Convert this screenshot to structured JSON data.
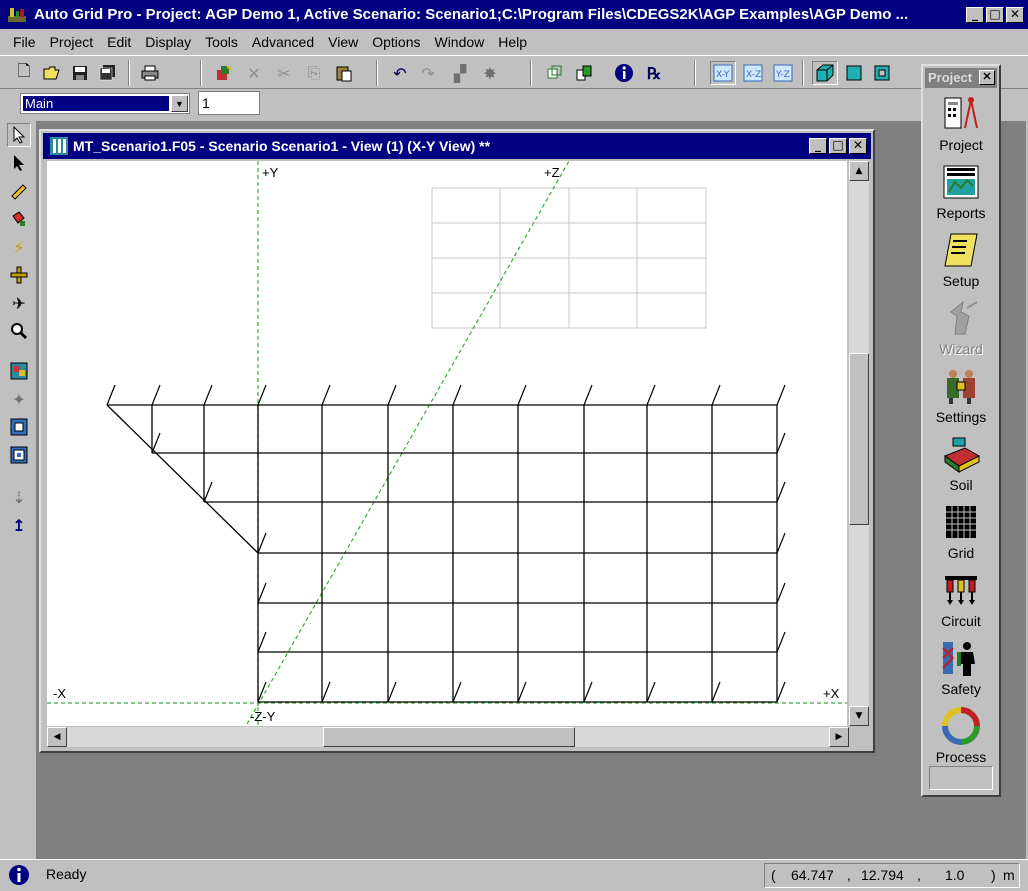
{
  "window": {
    "title": "Auto Grid Pro - Project: AGP Demo 1, Active Scenario: Scenario1;C:\\Program Files\\CDEGS2K\\AGP Examples\\AGP Demo ...",
    "min": "_",
    "max": "□",
    "close": "✕"
  },
  "menu": {
    "file": "File",
    "project": "Project",
    "edit": "Edit",
    "display": "Display",
    "tools": "Tools",
    "advanced": "Advanced",
    "view": "View",
    "options": "Options",
    "window": "Window",
    "help": "Help"
  },
  "toolbar2": {
    "scenario_value": "Main",
    "view_number": "1"
  },
  "child": {
    "title": "MT_Scenario1.F05 - Scenario Scenario1 - View (1) (X-Y View) **",
    "min": "_",
    "max": "□",
    "close": "✕"
  },
  "canvas": {
    "axis_plus_y": "+Y",
    "axis_plus_z": "+Z",
    "axis_minus_x": "-X",
    "axis_plus_x": "+X",
    "axis_minus_z_minus_y": "-Z-Y"
  },
  "palette": {
    "title": "Project",
    "close": "✕",
    "items": [
      {
        "label": "Project",
        "icon": "project-icon",
        "enabled": true
      },
      {
        "label": "Reports",
        "icon": "reports-icon",
        "enabled": true
      },
      {
        "label": "Setup",
        "icon": "setup-icon",
        "enabled": true
      },
      {
        "label": "Wizard",
        "icon": "wizard-icon",
        "enabled": false
      },
      {
        "label": "Settings",
        "icon": "settings-icon",
        "enabled": true
      },
      {
        "label": "Soil",
        "icon": "soil-icon",
        "enabled": true
      },
      {
        "label": "Grid",
        "icon": "grid-icon",
        "enabled": true
      },
      {
        "label": "Circuit",
        "icon": "circuit-icon",
        "enabled": true
      },
      {
        "label": "Safety",
        "icon": "safety-icon",
        "enabled": true
      },
      {
        "label": "Process",
        "icon": "process-icon",
        "enabled": true
      }
    ]
  },
  "status": {
    "text": "Ready",
    "open": "(",
    "x": "64.747",
    "sep1": ",",
    "y": "12.794",
    "sep2": ",",
    "z": "1.0",
    "close": ")",
    "unit": "m"
  },
  "colors": {
    "titlebar": "#000080",
    "face": "#c0c0c0",
    "mdi_background": "#808080",
    "axis_guides": "#3aaa3a",
    "grid_lines": "#000000"
  }
}
